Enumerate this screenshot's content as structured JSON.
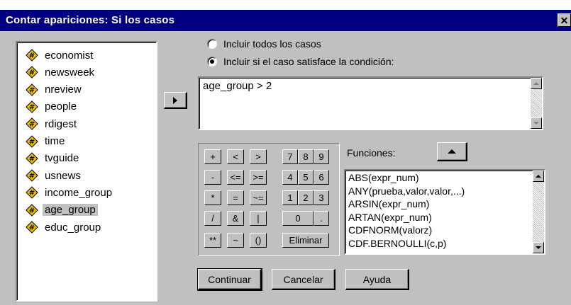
{
  "window": {
    "title": "Contar apariciones: Si los casos",
    "close_label": "✕"
  },
  "variables": [
    {
      "label": "economist",
      "icon": "numeric-variable-icon"
    },
    {
      "label": "newsweek",
      "icon": "numeric-variable-icon"
    },
    {
      "label": "nreview",
      "icon": "numeric-variable-icon"
    },
    {
      "label": "people",
      "icon": "numeric-variable-icon"
    },
    {
      "label": "rdigest",
      "icon": "numeric-variable-icon"
    },
    {
      "label": "time",
      "icon": "numeric-variable-icon"
    },
    {
      "label": "tvguide",
      "icon": "numeric-variable-icon"
    },
    {
      "label": "usnews",
      "icon": "numeric-variable-icon"
    },
    {
      "label": "income_group",
      "icon": "numeric-variable-icon"
    },
    {
      "label": "age_group",
      "icon": "numeric-variable-icon",
      "selected": true
    },
    {
      "label": "educ_group",
      "icon": "numeric-variable-icon"
    }
  ],
  "options": {
    "all_cases": "Incluir todos los casos",
    "if_condition": "Incluir si el caso satisface la condición:",
    "selected": "if_condition"
  },
  "condition": {
    "value": "age_group > 2"
  },
  "keypad": {
    "rows": [
      [
        "+",
        "<",
        ">",
        "7",
        "8",
        "9"
      ],
      [
        "-",
        "<=",
        ">=",
        "4",
        "5",
        "6"
      ],
      [
        "*",
        "=",
        "~=",
        "1",
        "2",
        "3"
      ],
      [
        "/",
        "&",
        "|",
        "0",
        "."
      ],
      [
        "**",
        "~",
        "()",
        "Eliminar"
      ]
    ]
  },
  "functions": {
    "label": "Funciones:",
    "items": [
      "ABS(expr_num)",
      "ANY(prueba,valor,valor,...)",
      "ARSIN(expr_num)",
      "ARTAN(expr_num)",
      "CDFNORM(valorz)",
      "CDF.BERNOULLI(c,p)"
    ]
  },
  "buttons": {
    "continue": "Continuar",
    "cancel": "Cancelar",
    "help": "Ayuda"
  },
  "colors": {
    "titlebar": "#000080",
    "dialog": "#c0c0c0",
    "icon_fill": "#f0c000"
  }
}
